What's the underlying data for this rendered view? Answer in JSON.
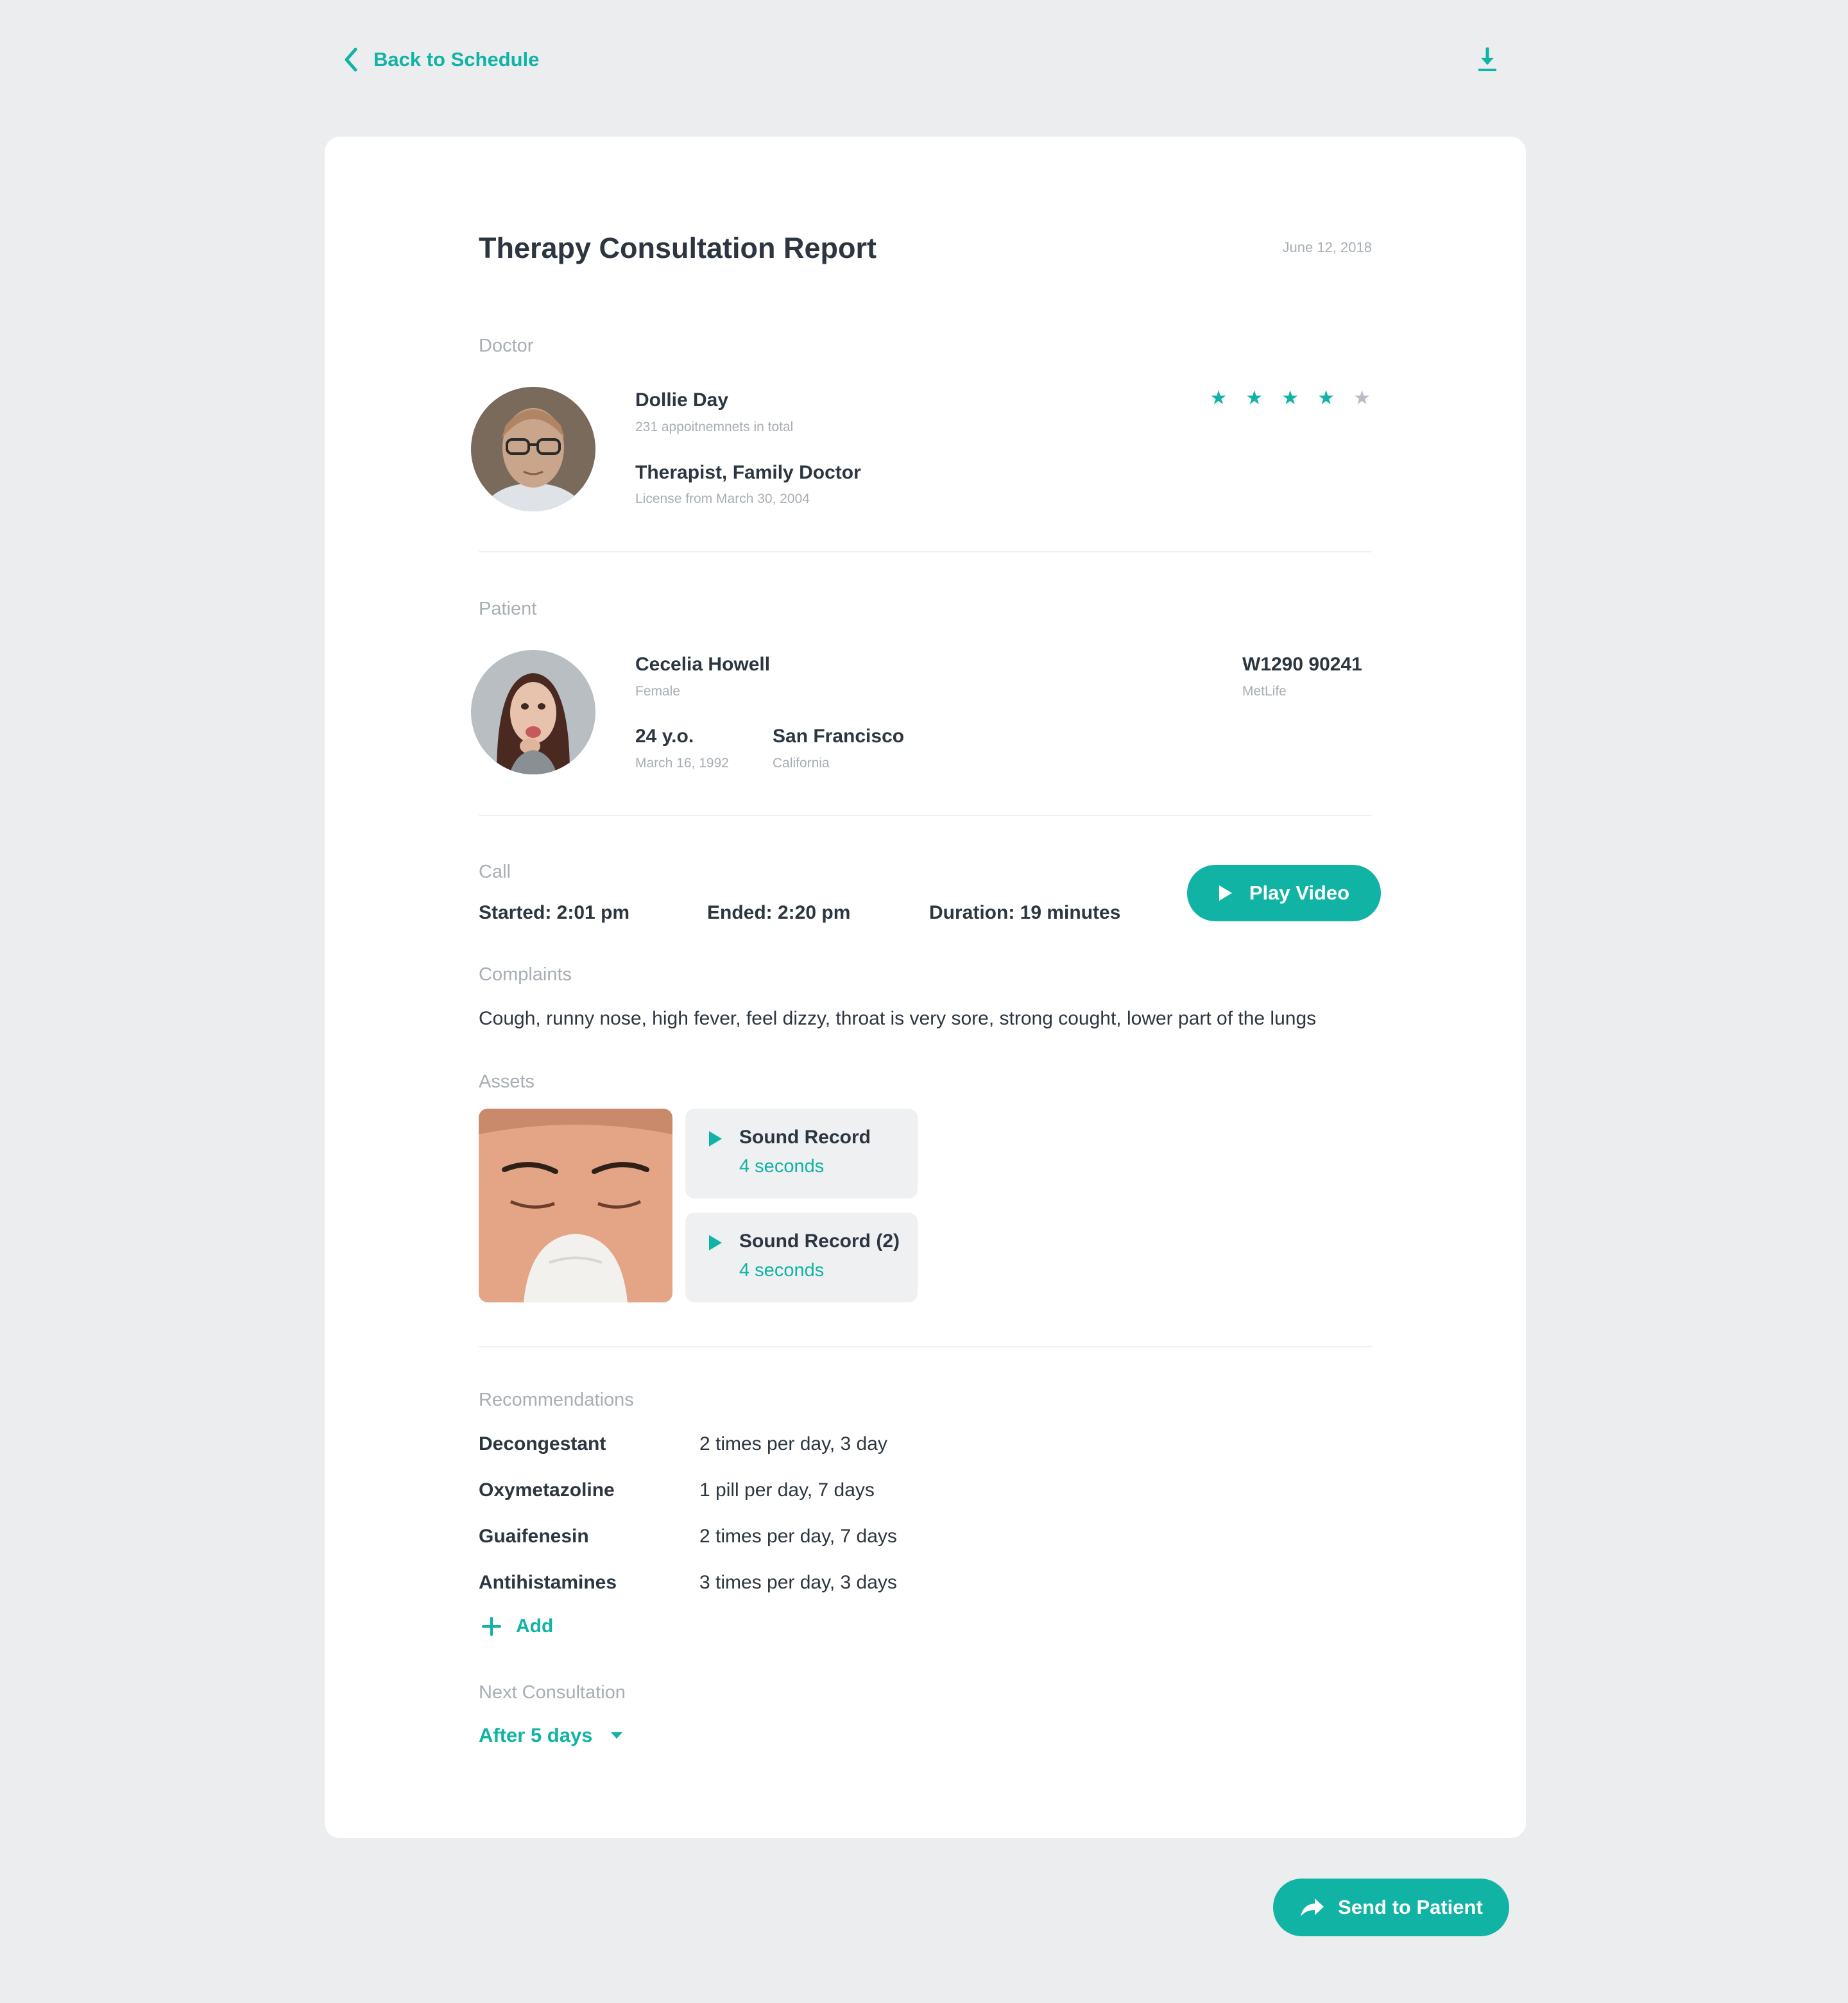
{
  "nav": {
    "back_label": "Back to Schedule"
  },
  "report": {
    "title": "Therapy Consultation Report",
    "date": "June 12, 2018"
  },
  "doctor": {
    "section_label": "Doctor",
    "name": "Dollie Day",
    "appointments": "231 appoitnemnets in total",
    "specialty": "Therapist, Family Doctor",
    "license": "License from March 30, 2004",
    "rating": 4,
    "rating_max": 5
  },
  "patient": {
    "section_label": "Patient",
    "name": "Cecelia Howell",
    "gender": "Female",
    "age": "24 y.o.",
    "birthdate": "March 16, 1992",
    "city": "San Francisco",
    "state": "California",
    "insurance_id": "W1290 90241",
    "insurer": "MetLife"
  },
  "call": {
    "section_label": "Call",
    "started": "Started: 2:01 pm",
    "ended": "Ended: 2:20 pm",
    "duration": "Duration: 19 minutes",
    "play_label": "Play Video"
  },
  "complaints": {
    "section_label": "Complaints",
    "text": "Cough, runny nose, high fever, feel dizzy, throat is very sore, strong cought, lower part of the lungs"
  },
  "assets": {
    "section_label": "Assets",
    "sounds": [
      {
        "title": "Sound Record",
        "duration": "4 seconds"
      },
      {
        "title": "Sound Record (2)",
        "duration": "4 seconds"
      }
    ]
  },
  "recommendations": {
    "section_label": "Recommendations",
    "items": [
      {
        "name": "Decongestant",
        "dose": "2 times per day, 3 day"
      },
      {
        "name": "Oxymetazoline",
        "dose": "1 pill per day, 7 days"
      },
      {
        "name": "Guaifenesin",
        "dose": "2 times per day, 7 days"
      },
      {
        "name": "Antihistamines",
        "dose": "3 times per day, 3 days"
      }
    ],
    "add_label": "Add"
  },
  "next": {
    "section_label": "Next Consultation",
    "value": "After 5 days"
  },
  "footer": {
    "send_label": "Send to Patient"
  },
  "colors": {
    "accent": "#11b3a4",
    "background": "#ebedef",
    "text": "#2d3640",
    "muted": "#a7aeb4"
  }
}
